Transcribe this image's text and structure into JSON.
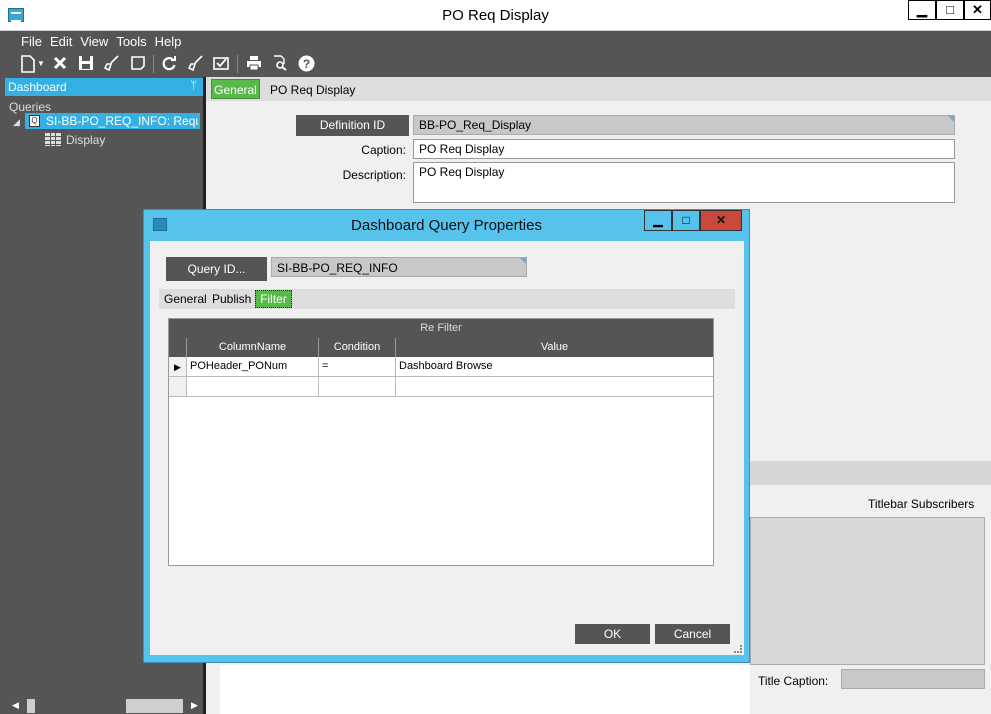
{
  "window": {
    "title": "PO Req Display",
    "min_glyph": "▁",
    "max_glyph": "□",
    "close_glyph": "✕"
  },
  "menu": [
    "File",
    "Edit",
    "View",
    "Tools",
    "Help"
  ],
  "toolbar": {
    "icons": [
      "new-icon",
      "dropdown-icon",
      "delete-icon",
      "save-icon",
      "clear-icon",
      "note-icon",
      "refresh-icon",
      "clear-all-icon",
      "check-icon",
      "print-icon",
      "print-preview-icon",
      "help-icon"
    ]
  },
  "dashboard_panel": {
    "header": "Dashboard",
    "pin_glyph": "ᛘ",
    "queries_label": "Queries",
    "query_item": "SI-BB-PO_REQ_INFO: Requi",
    "display_item": "Display"
  },
  "main_form": {
    "tabs": [
      "General",
      "PO Req Display"
    ],
    "definition_id_label": "Definition ID",
    "definition_id_value": "BB-PO_Req_Display",
    "caption_label": "Caption:",
    "caption_value": "PO Req Display",
    "description_label": "Description:",
    "description_value": "PO Req Display",
    "titlebar_subscribers_label": "Titlebar Subscribers",
    "title_caption_label": "Title Caption:",
    "title_caption_value": ""
  },
  "dialog": {
    "title": "Dashboard Query Properties",
    "min_glyph": "▁",
    "max_glyph": "□",
    "close_glyph": "✕",
    "query_id_label": "Query ID...",
    "query_id_value": "SI-BB-PO_REQ_INFO",
    "tabs": [
      "General",
      "Publish",
      "Filter"
    ],
    "active_tab": "Filter",
    "grid": {
      "caption": "Re Filter",
      "columns": [
        "ColumnName",
        "Condition",
        "Value"
      ],
      "rows": [
        {
          "column_name": "POHeader_PONum",
          "condition": "=",
          "value": "Dashboard Browse"
        },
        {
          "column_name": "",
          "condition": "",
          "value": ""
        }
      ]
    },
    "ok_label": "OK",
    "cancel_label": "Cancel"
  },
  "colors": {
    "accent_blue": "#36b0e3",
    "active_tab_green": "#59b94a",
    "dark_chrome": "#555555"
  }
}
